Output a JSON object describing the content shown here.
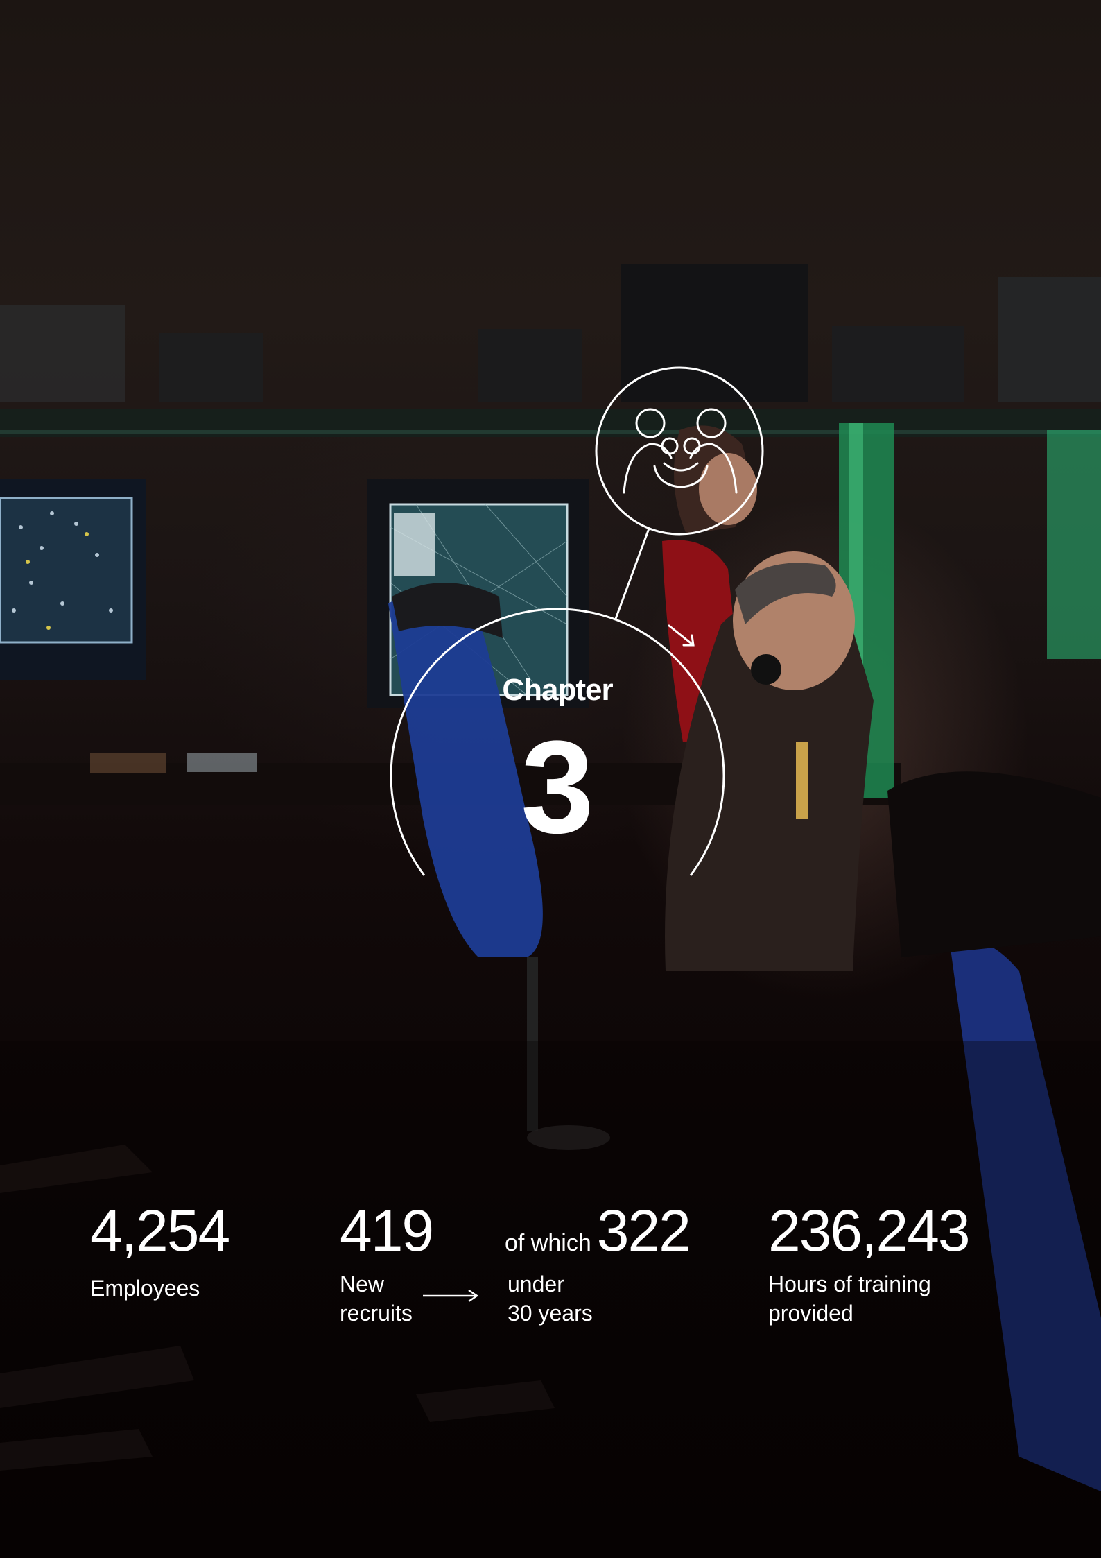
{
  "chapter": {
    "label": "Chapter",
    "number": "3",
    "icon": "family-people-icon"
  },
  "stats": {
    "employees": {
      "value": "4,254",
      "label": "Employees"
    },
    "recruits": {
      "value": "419",
      "label_line1": "New",
      "label_line2": "recruits"
    },
    "under30": {
      "prefix": "of which",
      "value": "322",
      "label_line1": "under",
      "label_line2": "30 years"
    },
    "training": {
      "value": "236,243",
      "label_line1": "Hours of training",
      "label_line2": "provided"
    }
  },
  "colors": {
    "background": "#0b0606",
    "text": "#ffffff",
    "chair_blue": "#1f3f9a",
    "red_top": "#a3141c",
    "green_accent": "#2bb36a"
  }
}
